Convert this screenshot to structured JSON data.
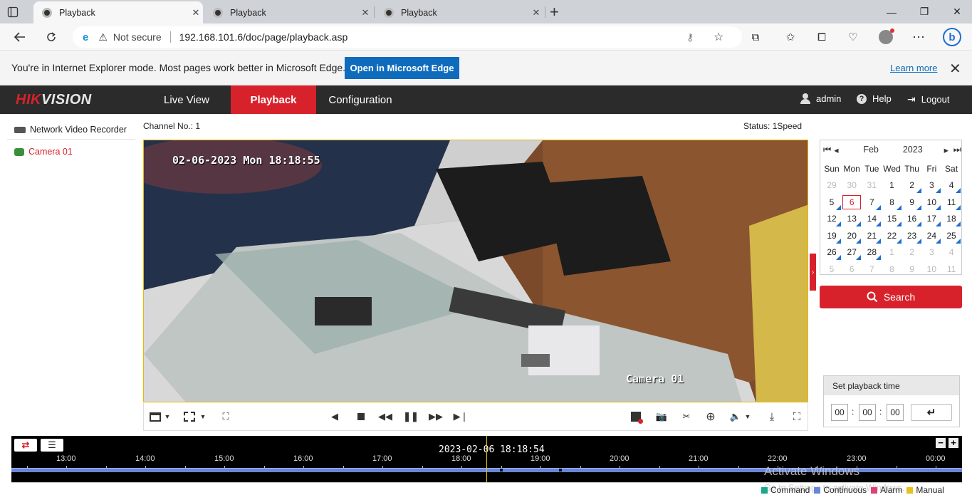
{
  "browser": {
    "tabs": [
      {
        "label": "Playback"
      },
      {
        "label": "Playback"
      },
      {
        "label": "Playback"
      }
    ],
    "new_tab_label": "+",
    "security_label": "Not secure",
    "url": "192.168.101.6/doc/page/playback.asp"
  },
  "ie_banner": {
    "message": "You're in Internet Explorer mode. Most pages work better in Microsoft Edge.",
    "button_label": "Open in Microsoft Edge",
    "learn_more": "Learn more"
  },
  "app": {
    "logo_part1": "HIK",
    "logo_part2": "VISION",
    "nav": [
      {
        "label": "Live View"
      },
      {
        "label": "Playback"
      },
      {
        "label": "Configuration"
      }
    ],
    "active_nav": "Playback",
    "user": "admin",
    "help": "Help",
    "logout": "Logout",
    "accent_color": "#d8222b"
  },
  "tree": {
    "root": "Network Video Recorder",
    "camera": "Camera 01"
  },
  "player": {
    "channel_label": "Channel No.: 1",
    "status_label": "Status: 1Speed",
    "osd_timestamp": "02-06-2023 Mon 18:18:55",
    "osd_camera": "Camera 01"
  },
  "calendar": {
    "month": "Feb",
    "year": "2023",
    "weekdays": [
      "Sun",
      "Mon",
      "Tue",
      "Wed",
      "Thu",
      "Fri",
      "Sat"
    ],
    "selected_day": "6",
    "weeks": [
      [
        "29",
        "30",
        "31",
        "1",
        "2",
        "3",
        "4"
      ],
      [
        "5",
        "6",
        "7",
        "8",
        "9",
        "10",
        "11"
      ],
      [
        "12",
        "13",
        "14",
        "15",
        "16",
        "17",
        "18"
      ],
      [
        "19",
        "20",
        "21",
        "22",
        "23",
        "24",
        "25"
      ],
      [
        "26",
        "27",
        "28",
        "1",
        "2",
        "3",
        "4"
      ],
      [
        "5",
        "6",
        "7",
        "8",
        "9",
        "10",
        "11"
      ]
    ],
    "search_label": "Search"
  },
  "playback_time": {
    "title": "Set playback time",
    "hh": "00",
    "mm": "00",
    "ss": "00",
    "separator": ":"
  },
  "timeline": {
    "current": "2023-02-06 18:18:54",
    "ticks": [
      "13:00",
      "14:00",
      "15:00",
      "16:00",
      "17:00",
      "18:00",
      "19:00",
      "20:00",
      "21:00",
      "22:00",
      "23:00",
      "00:00"
    ],
    "legend": [
      {
        "label": "Command",
        "color": "#1aa78a"
      },
      {
        "label": "Continuous",
        "color": "#6b86d6"
      },
      {
        "label": "Alarm",
        "color": "#e0407a"
      },
      {
        "label": "Manual",
        "color": "#e6c21a"
      }
    ]
  },
  "os_watermark": {
    "line1": "Activate Windows",
    "line2": "Go to Settings to activate Windows."
  }
}
